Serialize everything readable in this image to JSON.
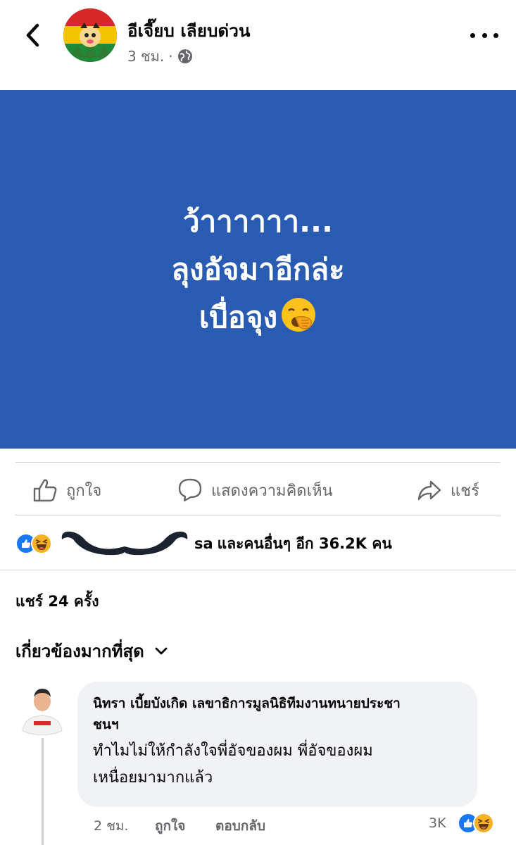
{
  "header": {
    "page_name": "อีเจี๊ยบ เลียบด่วน",
    "time": "3 ชม.",
    "separator": "·"
  },
  "post": {
    "lines": [
      "ว้าาาาาา...",
      "ลุงอัจมาอีกล่ะ",
      "เบื่อจุง"
    ],
    "emoji": "yawning-face",
    "background_color": "#2a5bb3",
    "text_color": "#ffffff"
  },
  "actions": {
    "like": "ถูกใจ",
    "comment": "แสดงความคิดเห็น",
    "share": "แชร์"
  },
  "reactions": {
    "icons": [
      "like",
      "haha"
    ],
    "partial_name_suffix": "sa",
    "summary": "และคนอื่นๆ อีก 36.2K คน"
  },
  "shares": "แชร์ 24 ครั้ง",
  "sort": {
    "label": "เกี่ยวข้องมากที่สุด"
  },
  "comment": {
    "author": "นิทรา เบี้ยบังเกิด เลขาธิการมูลนิธิทีมงานทนายประชาชนฯ",
    "author_line1": "นิทรา เบี้ยบังเกิด เลขาธิการมูลนิธิทีมงานทนายประชา",
    "author_line2": "ชนฯ",
    "text_line1": "ทำไมไม่ให้กำลังใจพี่อัจของผม พี่อัจของผม",
    "text_line2": "เหนื่อยมามากแล้ว",
    "time": "2 ชม.",
    "like": "ถูกใจ",
    "reply": "ตอบกลับ",
    "reaction_count": "3K"
  },
  "colors": {
    "facebook_blue": "#1877f2",
    "haha_yellow": "#f7b125",
    "secondary_text": "#65676b"
  }
}
